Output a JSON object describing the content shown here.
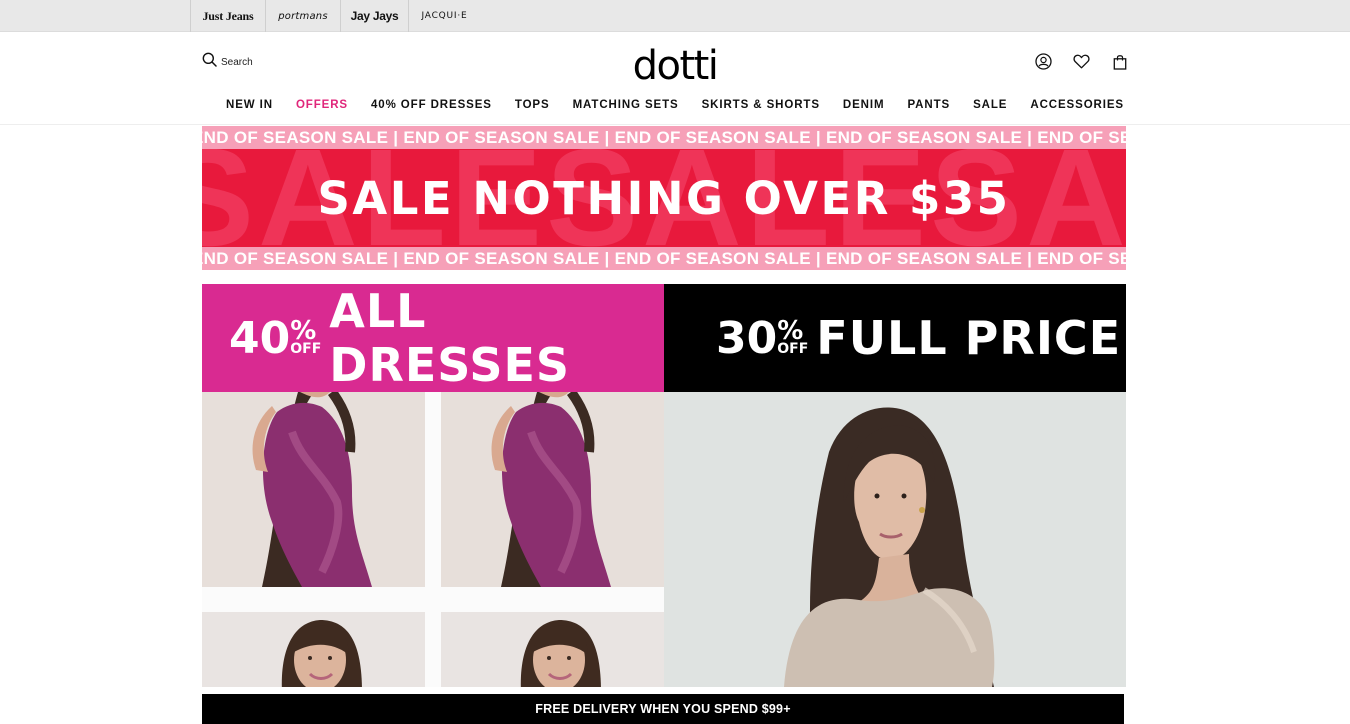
{
  "brands": {
    "items": [
      "Just Jeans",
      "portmans",
      "Jay Jays",
      "JACQUI·E"
    ]
  },
  "header": {
    "search_label": "Search",
    "logo": "dotti",
    "icons": [
      "account-icon",
      "heart-icon",
      "bag-icon"
    ]
  },
  "nav": {
    "items": [
      "NEW IN",
      "OFFERS",
      "40% OFF DRESSES",
      "TOPS",
      "MATCHING SETS",
      "SKIRTS & SHORTS",
      "DENIM",
      "PANTS",
      "SALE",
      "ACCESSORIES"
    ],
    "highlight_color": "#e0267a"
  },
  "sale_banner": {
    "ticker_text": "END OF SEASON SALE",
    "headline": "SALE NOTHING OVER $35",
    "background_word": "SALE",
    "colors": {
      "main": "#e8193c",
      "ticker": "#f6a0b8"
    }
  },
  "promo_left": {
    "percent": "40",
    "percent_symbol": "%",
    "off": "OFF",
    "label": "ALL DRESSES",
    "color": "#d92a91"
  },
  "promo_right": {
    "percent": "30",
    "percent_symbol": "%",
    "off": "OFF",
    "label": "FULL PRICE",
    "color": "#000000"
  },
  "delivery": {
    "text": "FREE DELIVERY WHEN YOU SPEND $99+"
  }
}
